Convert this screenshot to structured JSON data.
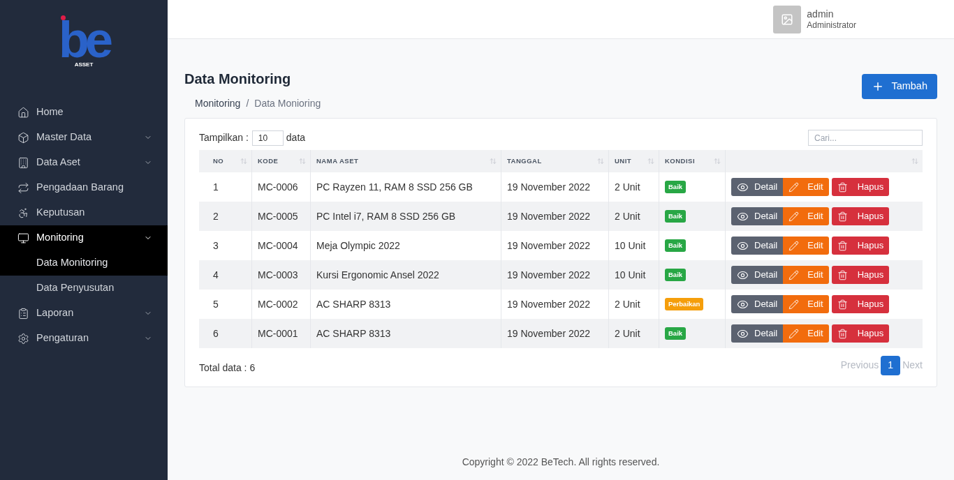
{
  "logo": {
    "mark": "be",
    "caption": "ASSET"
  },
  "sidebar": {
    "items": [
      {
        "kind": "link",
        "label": "Home",
        "selected": false
      },
      {
        "kind": "group",
        "label": "Master Data",
        "selected": false,
        "expanded": false
      },
      {
        "kind": "group",
        "label": "Data Aset",
        "selected": false,
        "expanded": false
      },
      {
        "kind": "link",
        "label": "Pengadaan Barang",
        "selected": false
      },
      {
        "kind": "link",
        "label": "Keputusan",
        "selected": false
      },
      {
        "kind": "group",
        "label": "Monitoring",
        "selected": true,
        "expanded": true,
        "children": [
          {
            "label": "Data Monitoring",
            "selected": true
          },
          {
            "label": "Data Penyusutan",
            "selected": false
          }
        ]
      },
      {
        "kind": "group",
        "label": "Laporan",
        "selected": false,
        "expanded": false
      },
      {
        "kind": "group",
        "label": "Pengaturan",
        "selected": false,
        "expanded": false
      }
    ]
  },
  "user": {
    "name": "admin",
    "role": "Administrator"
  },
  "page": {
    "title": "Data Monitoring",
    "breadcrumb": [
      "Monitoring",
      "Data Monioring"
    ],
    "breadcrumb_separator": "/",
    "add_button": "Tambah"
  },
  "table_controls": {
    "show_label": "Tampilkan :",
    "show_value": "10",
    "show_suffix": "data",
    "search_placeholder": "Cari..."
  },
  "table": {
    "columns": [
      "NO",
      "KODE",
      "NAMA ASET",
      "TANGGAL",
      "UNIT",
      "KONDISI",
      ""
    ],
    "rows": [
      {
        "no": "1",
        "kode": "MC-0006",
        "nama": "PC Rayzen 11, RAM 8 SSD 256 GB",
        "tanggal": "19 November 2022",
        "unit": "2 Unit",
        "kondisi": "Baik",
        "color": "#28a745",
        "actions": [
          "Detail",
          "Edit",
          "Hapus"
        ]
      },
      {
        "no": "2",
        "kode": "MC-0005",
        "nama": "PC Intel i7, RAM 8 SSD 256 GB",
        "tanggal": "19 November 2022",
        "unit": "2 Unit",
        "kondisi": "Baik",
        "color": "#28a745",
        "actions": [
          "Detail",
          "Edit",
          "Hapus"
        ]
      },
      {
        "no": "3",
        "kode": "MC-0004",
        "nama": "Meja Olympic 2022",
        "tanggal": "19 November 2022",
        "unit": "10 Unit",
        "kondisi": "Baik",
        "color": "#28a745",
        "actions": [
          "Detail",
          "Edit",
          "Hapus"
        ]
      },
      {
        "no": "4",
        "kode": "MC-0003",
        "nama": "Kursi Ergonomic Ansel 2022",
        "tanggal": "19 November 2022",
        "unit": "10 Unit",
        "kondisi": "Baik",
        "color": "#28a745",
        "actions": [
          "Detail",
          "Edit",
          "Hapus"
        ]
      },
      {
        "no": "5",
        "kode": "MC-0002",
        "nama": "AC SHARP 8313",
        "tanggal": "19 November 2022",
        "unit": "2 Unit",
        "kondisi": "Perbaikan",
        "color": "#f59e0b",
        "actions": [
          "Detail",
          "Edit",
          "Hapus"
        ]
      },
      {
        "no": "6",
        "kode": "MC-0001",
        "nama": "AC SHARP 8313",
        "tanggal": "19 November 2022",
        "unit": "2 Unit",
        "kondisi": "Baik",
        "color": "#28a745",
        "actions": [
          "Detail",
          "Edit",
          "Hapus"
        ]
      }
    ]
  },
  "footer_table": {
    "total": "Total data : 6",
    "pagination": {
      "previous": {
        "label": "Previous",
        "disabled": true
      },
      "pages": [
        {
          "label": "1",
          "selected": true
        }
      ],
      "next": {
        "label": "Next",
        "disabled": true
      }
    }
  },
  "footer": "Copyright © 2022 BeTech. All rights reserved."
}
